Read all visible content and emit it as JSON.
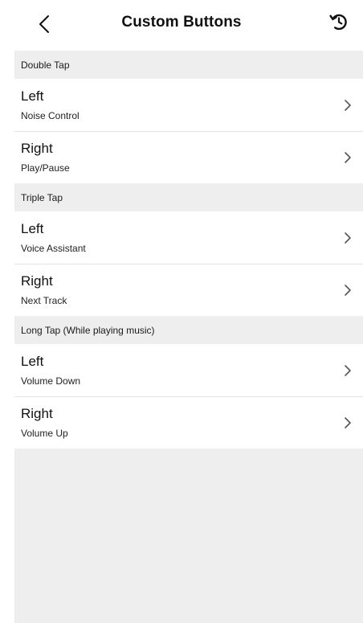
{
  "header": {
    "title": "Custom Buttons",
    "back_icon": "chevron-left-icon",
    "reset_icon": "reset-icon"
  },
  "sections": [
    {
      "header": "Double Tap",
      "rows": [
        {
          "title": "Left",
          "value": "Noise Control"
        },
        {
          "title": "Right",
          "value": "Play/Pause"
        }
      ]
    },
    {
      "header": "Triple Tap",
      "rows": [
        {
          "title": "Left",
          "value": "Voice Assistant"
        },
        {
          "title": "Right",
          "value": "Next Track"
        }
      ]
    },
    {
      "header": "Long Tap (While playing music)",
      "rows": [
        {
          "title": "Left",
          "value": "Volume Down"
        },
        {
          "title": "Right",
          "value": "Volume Up"
        }
      ]
    }
  ],
  "colors": {
    "background": "#ffffff",
    "group_background": "#eeeeee",
    "text": "#111111",
    "chevron": "#555555"
  }
}
